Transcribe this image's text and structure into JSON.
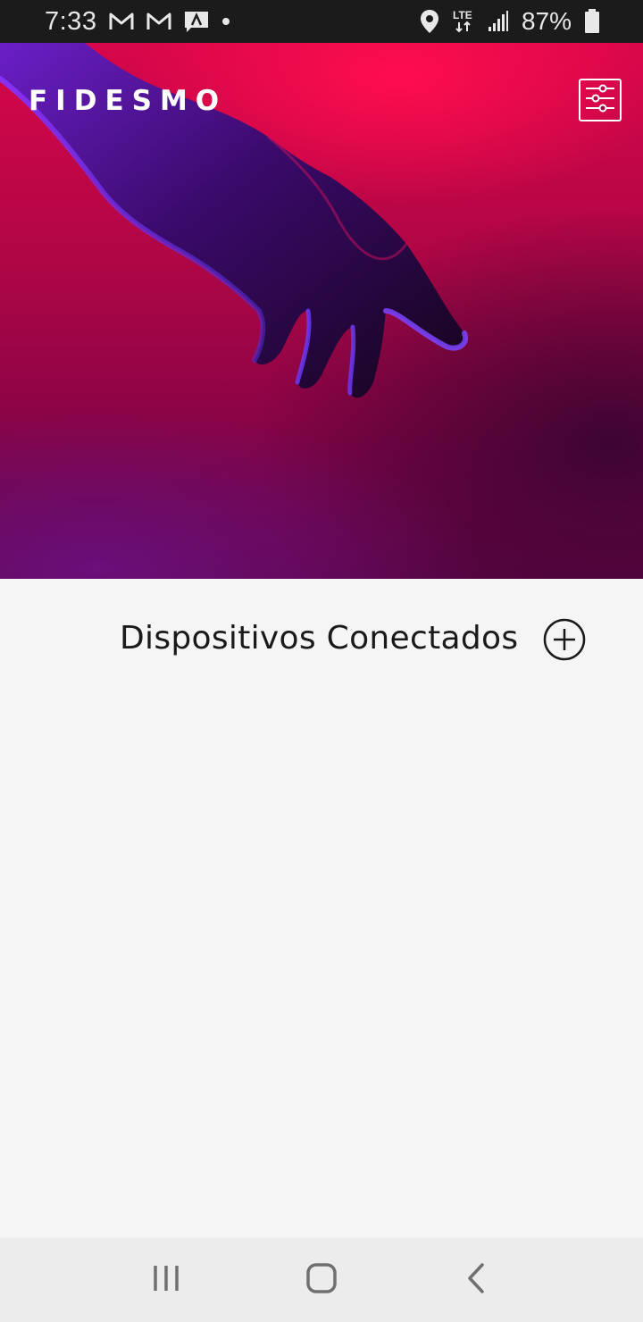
{
  "status_bar": {
    "time": "7:33",
    "network": "LTE",
    "battery": "87%",
    "icons": [
      "gmail-icon",
      "gmail-icon",
      "news-icon",
      "dot-icon",
      "location-icon",
      "lte-icon",
      "signal-icon",
      "battery-icon"
    ]
  },
  "header": {
    "logo": "FIDESMO",
    "settings_icon": "sliders-icon"
  },
  "main": {
    "section_title": "Dispositivos Conectados",
    "add_icon": "plus-circle-icon"
  },
  "nav": {
    "recents_icon": "recents-icon",
    "home_icon": "home-icon",
    "back_icon": "back-icon"
  },
  "colors": {
    "hero_top": "#d7074a",
    "hero_bottom": "#5d0445",
    "background": "#f5f5f5"
  }
}
